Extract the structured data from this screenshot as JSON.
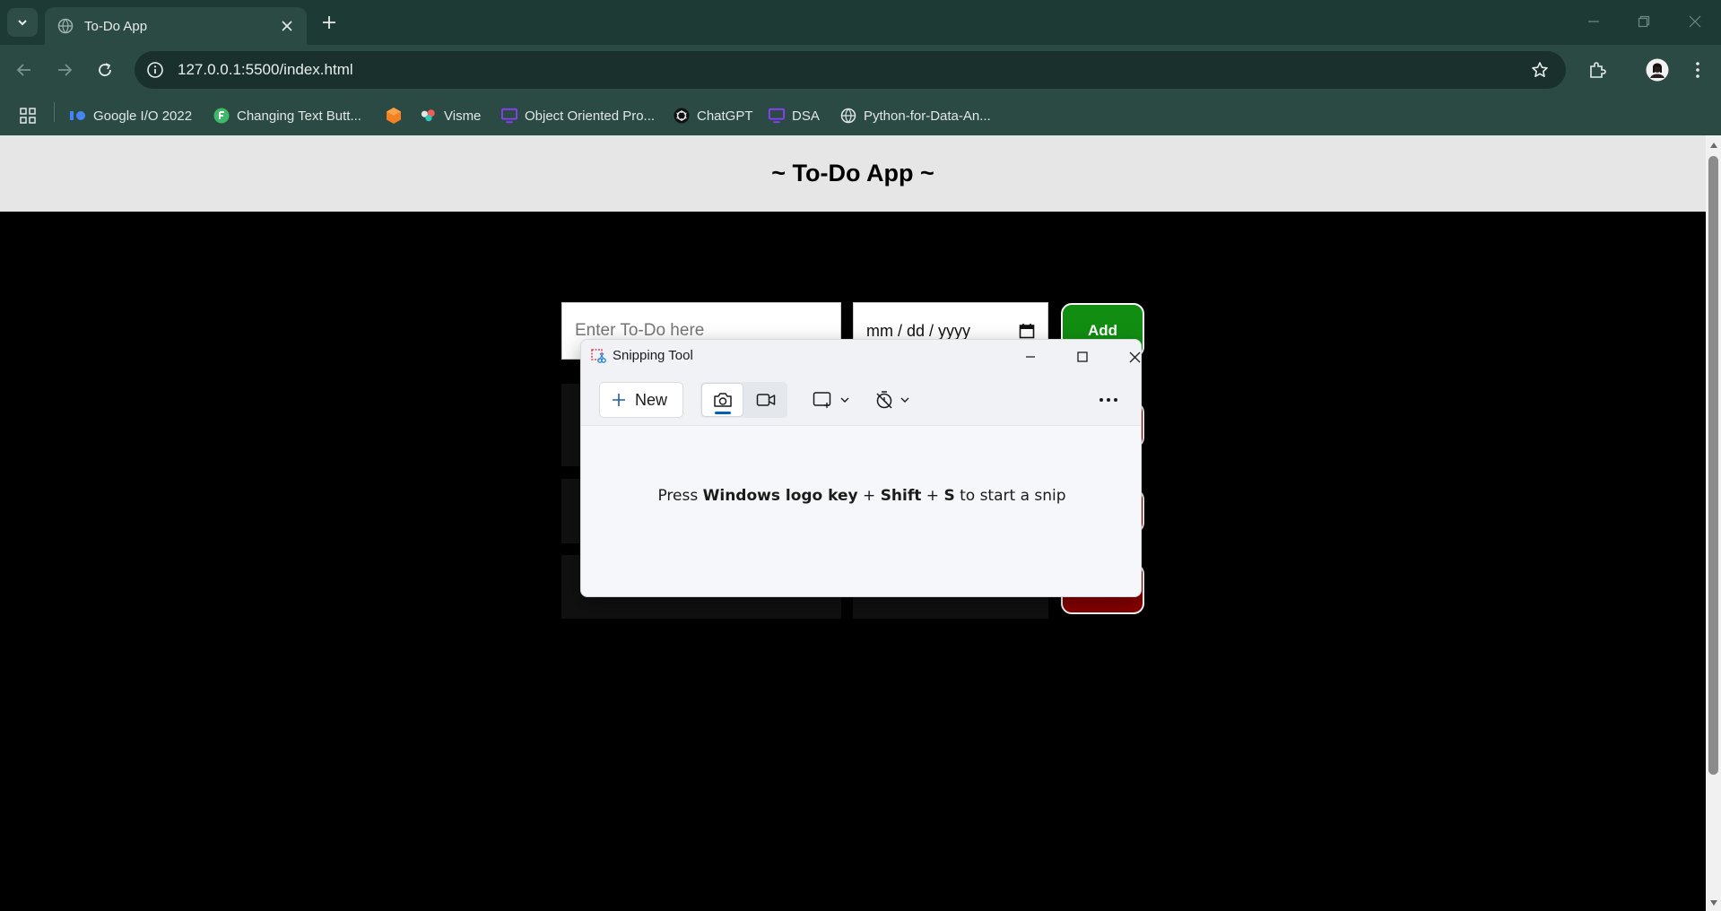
{
  "browser": {
    "tab_title": "To-Do App",
    "url": "127.0.0.1:5500/index.html",
    "bookmarks": [
      {
        "label": "Google I/O 2022",
        "icon": "google-io-icon"
      },
      {
        "label": "Changing Text Butt...",
        "icon": "f-letter-icon"
      },
      {
        "label": "",
        "icon": "hexagon-icon"
      },
      {
        "label": "Visme",
        "icon": "visme-icon"
      },
      {
        "label": "Object Oriented Pro...",
        "icon": "monitor-icon"
      },
      {
        "label": "ChatGPT",
        "icon": "chatgpt-icon"
      },
      {
        "label": "DSA",
        "icon": "monitor-icon"
      },
      {
        "label": "Python-for-Data-An...",
        "icon": "globe-icon"
      }
    ]
  },
  "page": {
    "title": "~ To-Do App ~",
    "todo_placeholder": "Enter To-Do here",
    "date_placeholder": "mm / dd / yyyy",
    "add_label": "Add"
  },
  "snipping_tool": {
    "title": "Snipping Tool",
    "new_label": "New",
    "message_prefix": "Press ",
    "message_keys1": "Windows logo key",
    "message_plus1": " + ",
    "message_keys2": "Shift",
    "message_plus2": " + ",
    "message_keys3": "S",
    "message_suffix": " to start a snip"
  },
  "colors": {
    "chrome_dark": "#1e3a35",
    "chrome": "#2c4a44",
    "add_green": "#118e11",
    "delete_red": "#8b0000",
    "accent_blue": "#005fb8"
  }
}
